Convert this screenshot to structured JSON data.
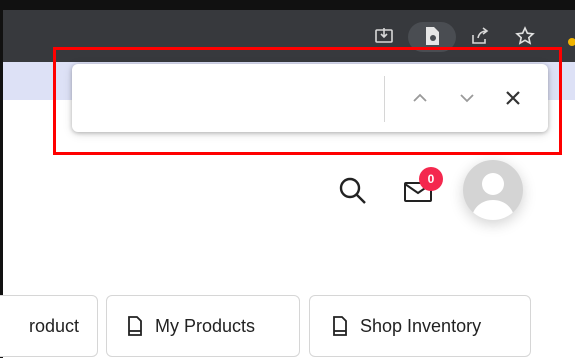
{
  "browser_toolbar": {
    "icons": [
      "install-app-icon",
      "page-icon",
      "share-icon",
      "bookmark-star-icon"
    ]
  },
  "find_bar": {
    "query": "",
    "placeholder": "",
    "match_count": "",
    "prev_icon": "chevron-up-icon",
    "next_icon": "chevron-down-icon",
    "close_icon": "close-icon"
  },
  "header": {
    "icons": [
      "search-icon",
      "mail-icon",
      "avatar"
    ],
    "notification_count": "0"
  },
  "actions": {
    "add_product_label": "roduct",
    "my_products_label": "My Products",
    "shop_inventory_label": "Shop Inventory"
  },
  "colors": {
    "browser_bar": "#37393d",
    "highlight_strip": "#dde1f6",
    "annotation_red": "#ff0000",
    "badge": "#f4284e"
  }
}
